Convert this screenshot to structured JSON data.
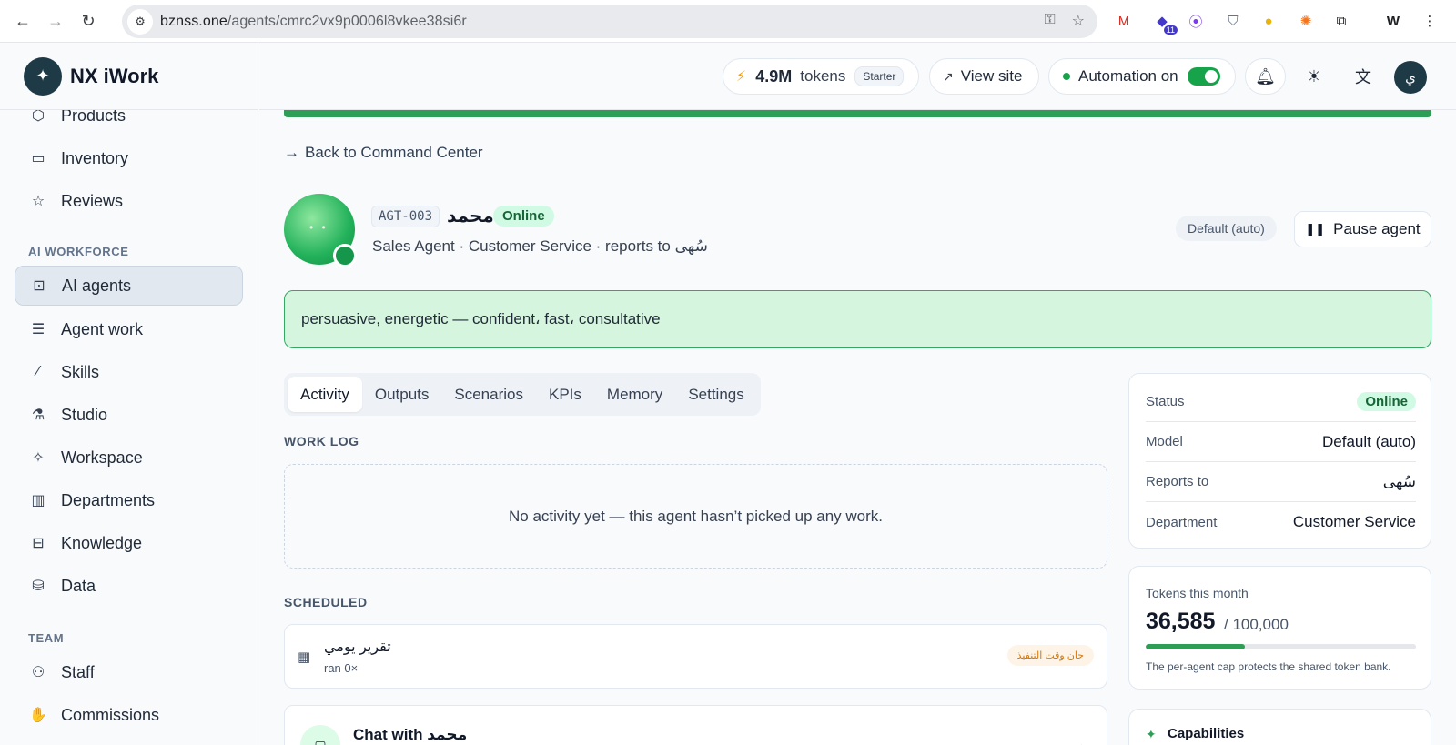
{
  "browser": {
    "url_host": "bznss.one",
    "url_path": "/agents/cmrc2vx9p0006l8vkee38si6r",
    "ext_badge_count": "11"
  },
  "sidebar": {
    "brand_name": "NX iWork",
    "items_top": [
      {
        "label": "Products",
        "icon": "box-icon"
      },
      {
        "label": "Inventory",
        "icon": "archive-icon"
      },
      {
        "label": "Reviews",
        "icon": "star-icon"
      }
    ],
    "section_ai": "AI WORKFORCE",
    "items_ai": [
      {
        "label": "AI agents",
        "icon": "bot-icon",
        "active": true
      },
      {
        "label": "Agent work",
        "icon": "list-check-icon"
      },
      {
        "label": "Skills",
        "icon": "wand-icon"
      },
      {
        "label": "Studio",
        "icon": "flask-icon"
      },
      {
        "label": "Workspace",
        "icon": "sparkles-icon"
      },
      {
        "label": "Departments",
        "icon": "building-icon"
      },
      {
        "label": "Knowledge",
        "icon": "book-icon"
      },
      {
        "label": "Data",
        "icon": "database-icon"
      }
    ],
    "section_team": "TEAM",
    "items_team": [
      {
        "label": "Staff",
        "icon": "users-icon"
      },
      {
        "label": "Commissions",
        "icon": "hand-coins-icon"
      }
    ]
  },
  "topbar": {
    "tokens_value": "4.9M",
    "tokens_label": "tokens",
    "plan": "Starter",
    "view_site": "View site",
    "automation_label": "Automation on",
    "automation_on": true,
    "avatar_initial": "ي"
  },
  "main": {
    "back_label": "Back to Command Center",
    "agent": {
      "code": "AGT-003",
      "name": "محمد",
      "status": "Online",
      "subtitle": "Sales Agent · Customer Service · reports to سُهى",
      "model_badge": "Default (auto)",
      "pause_label": "Pause agent",
      "persona": "persuasive, energetic — confident، fast، consultative"
    },
    "tabs": [
      "Activity",
      "Outputs",
      "Scenarios",
      "KPIs",
      "Memory",
      "Settings"
    ],
    "active_tab": "Activity",
    "work_log_title": "WORK LOG",
    "work_log_empty": "No activity yet — this agent hasn’t picked up any work.",
    "scheduled_title": "SCHEDULED",
    "scheduled": {
      "title": "تقرير يومي",
      "runs": "ran 0×",
      "badge": "حان وقت التنفيذ"
    },
    "chat_title": "Chat with محمد"
  },
  "info": {
    "status_label": "Status",
    "status_value": "Online",
    "model_label": "Model",
    "model_value": "Default (auto)",
    "reports_label": "Reports to",
    "reports_value": "سُهى",
    "department_label": "Department",
    "department_value": "Customer Service"
  },
  "tokens": {
    "title": "Tokens this month",
    "used": "36,585",
    "cap": "/ 100,000",
    "used_fraction": 0.366,
    "note": "The per-agent cap protects the shared token bank."
  },
  "capabilities": {
    "title": "Capabilities"
  },
  "colors": {
    "accent_green": "#2e9e57",
    "brand_dark": "#1f3a47",
    "persona_bg": "#d6f5df",
    "online_badge_bg": "#d1fae5"
  }
}
